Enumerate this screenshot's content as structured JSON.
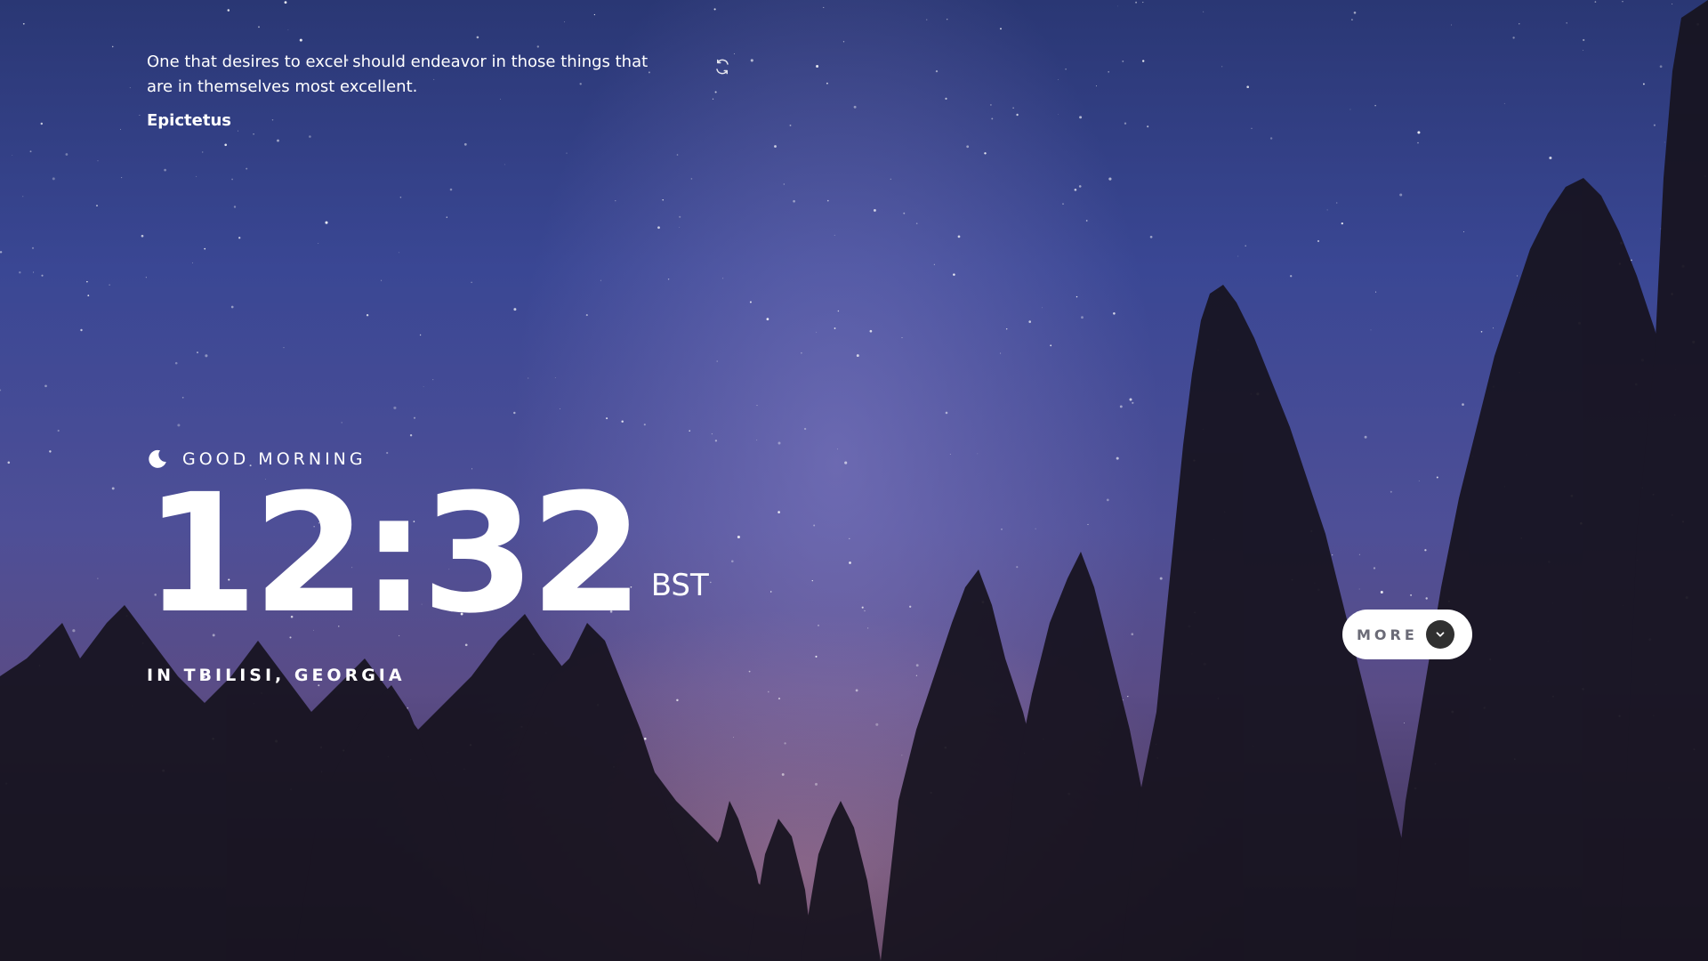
{
  "quote": {
    "text": "One that desires to excel should endeavor in those things that are in themselves most excellent.",
    "author": "Epictetus",
    "refresh_icon": "refresh-icon"
  },
  "greeting": {
    "icon": "moon-icon",
    "text": "GOOD MORNING"
  },
  "clock": {
    "time": "12:32",
    "timezone": "BST",
    "location": "IN TBILISI, GEORGIA"
  },
  "more_button": {
    "label": "MORE",
    "icon": "chevron-down-icon"
  },
  "colors": {
    "sky_top": "#2a3774",
    "sky_glow": "#5a4c86",
    "horizon": "#c08296",
    "tree_silhouette": "#17131f",
    "button_bg": "#ffffff",
    "button_text": "#6b6b77",
    "chevron_bg": "#303030"
  }
}
